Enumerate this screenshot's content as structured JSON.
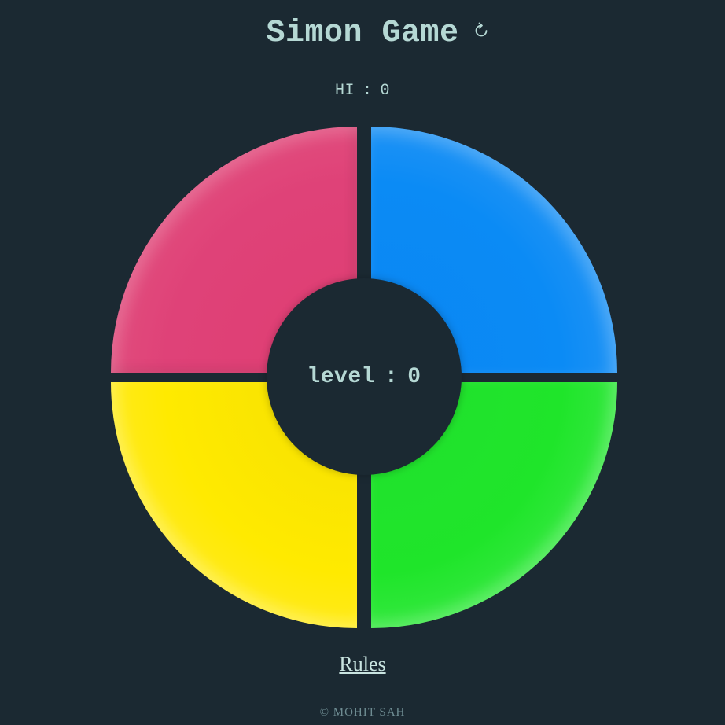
{
  "header": {
    "title": "Simon Game",
    "restart_icon": "restart-icon"
  },
  "score": {
    "hi_label": "HI",
    "separator": ":",
    "hi_value": "0"
  },
  "board": {
    "pads": [
      {
        "name": "red-pad",
        "color": "#df4278"
      },
      {
        "name": "blue-pad",
        "color": "#0b8bf5"
      },
      {
        "name": "yellow-pad",
        "color": "#ffea00"
      },
      {
        "name": "green-pad",
        "color": "#1fe52a"
      }
    ],
    "level_label": "level",
    "level_separator": ":",
    "level_value": "0"
  },
  "rules_label": "Rules",
  "footer": {
    "copyright": "© MOHIT SAH"
  },
  "colors": {
    "background": "#1b2932",
    "text": "#b5d8d4",
    "footer_text": "#6e8c92"
  }
}
